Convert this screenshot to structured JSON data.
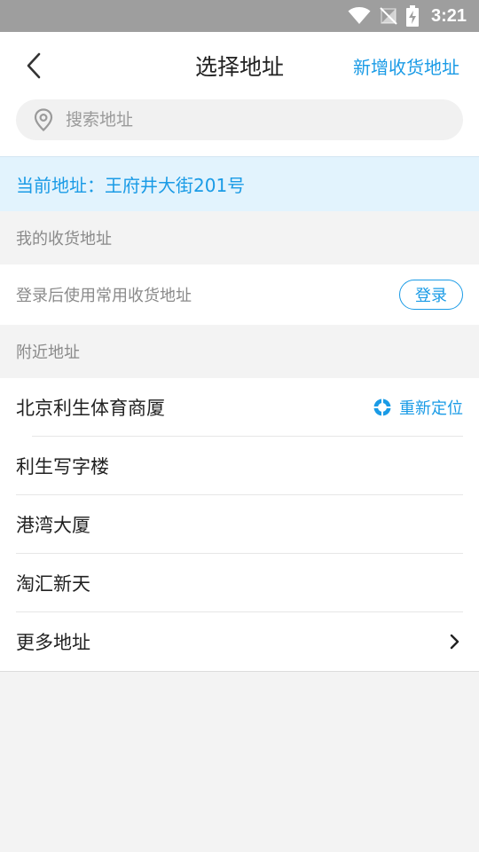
{
  "status_bar": {
    "time": "3:21",
    "icons": [
      "wifi-icon",
      "no-signal-icon",
      "battery-charging-icon"
    ]
  },
  "header": {
    "title": "选择地址",
    "add_label": "新增收货地址"
  },
  "search": {
    "placeholder": "搜索地址"
  },
  "current_address": {
    "text": "当前地址：王府井大街201号"
  },
  "my_addresses": {
    "title": "我的收货地址",
    "login_hint": "登录后使用常用收货地址",
    "login_button": "登录"
  },
  "nearby": {
    "title": "附近地址",
    "relocate_label": "重新定位",
    "items": [
      {
        "name": "北京利生体育商厦"
      },
      {
        "name": "利生写字楼"
      },
      {
        "name": "港湾大厦"
      },
      {
        "name": "淘汇新天"
      },
      {
        "name": "更多地址"
      }
    ]
  },
  "colors": {
    "accent": "#1a9be6",
    "status_bar": "#9e9e9e",
    "current_bg": "#e2f3fd",
    "page_bg": "#f3f3f3"
  }
}
